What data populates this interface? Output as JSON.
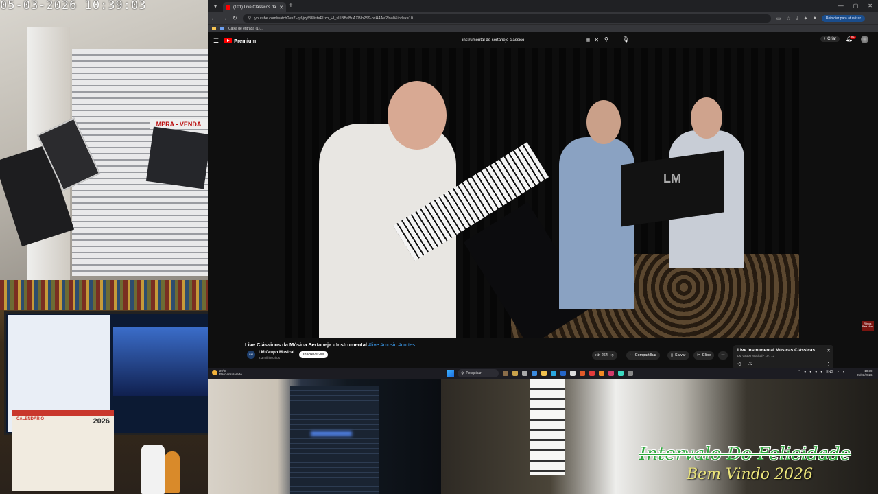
{
  "overlay": {
    "timestamp": "05-03-2026 10:39:03",
    "caption_line1": "Intervalo Do Felicidade",
    "caption_line2": "Bem Vindo 2026",
    "calendar_year": "2026",
    "calendar_title": "CALENDÁRIO",
    "shop_sign": "MPRA - VENDA"
  },
  "browser": {
    "tab_title": "(101) Live Clássicos da Mús...",
    "url": "youtube.com/watch?v=7l-qr6jvyf8&list=PLzb_Hl_sLIBBaBuAXBih2S9-bsH4Aw2foa0&index=10",
    "update_button": "Reiniciar para atualizar",
    "bookmark_label": "Caixa de entrada (1)..."
  },
  "youtube": {
    "brand": "Premium",
    "search_query": "instrumental de sertanejo classico",
    "create_label": "Criar",
    "notification_count": "9+",
    "video": {
      "title": "Live Clássicos da Música Sertaneja - Instrumental",
      "hashtags": "#live #music #cortes",
      "stand_logo": "LM"
    },
    "channel": {
      "name": "LM Grupo Musical",
      "subscribers": "2,3 mil inscritos",
      "avatar_text": "LM",
      "subscribe_label": "Inscrever-se"
    },
    "actions": {
      "likes": "264",
      "share": "Compartilhar",
      "save": "Salvar",
      "clip": "Clipe"
    },
    "playlist": {
      "title": "Live Instrumental Músicas Clássicas ...",
      "subtitle": "LM Grupo Musical - 10 / 13"
    },
    "corner_badge": "Ritmos Para Viver"
  },
  "taskbar": {
    "temperature": "29°C",
    "weather_desc": "Parc ensolarado",
    "search_label": "Pesquisar",
    "lang": "ENG",
    "time": "10:39",
    "date": "05/03/2026"
  }
}
